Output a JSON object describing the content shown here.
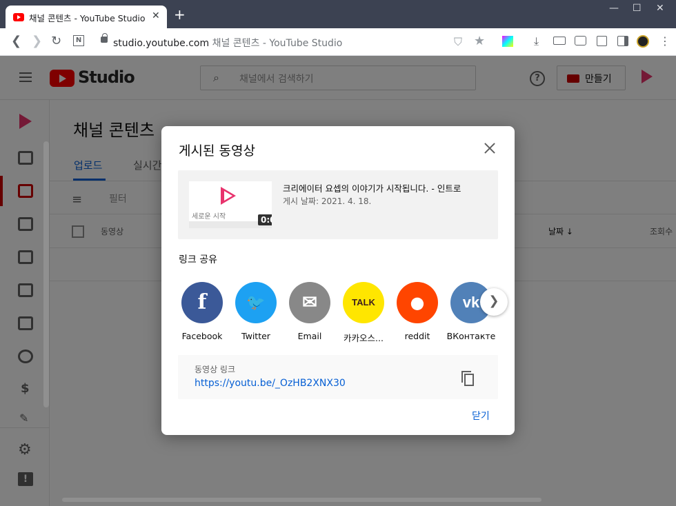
{
  "browser": {
    "tab_title": "채널 콘텐츠 - YouTube Studio",
    "tab_close": "✕",
    "new_tab": "+",
    "url_domain": "studio.youtube.com",
    "url_page_title": "채널 콘텐츠 - YouTube Studio",
    "window_controls": {
      "minimize": "—",
      "maximize": "☐",
      "close": "✕"
    }
  },
  "studio": {
    "logo_text": "Studio",
    "search_placeholder": "채널에서 검색하기",
    "create_label": "만들기",
    "page_title": "채널 콘텐츠",
    "tabs": [
      "업로드",
      "실시간"
    ],
    "filter_label": "필터",
    "columns": {
      "video": "동영상",
      "date": "날짜 ↓",
      "views": "조회수"
    }
  },
  "dialog": {
    "title": "게시된 동영상",
    "video": {
      "title": "크리에이터 요셉의 이야기가 시작됩니다. - 인트로",
      "published": "게시 날짜: 2021. 4. 18.",
      "duration": "0:08",
      "thumb_caption": "세로운 시작"
    },
    "share_label": "링크 공유",
    "share_targets": [
      {
        "name": "Facebook",
        "glyph": "f",
        "color": "#3b5998"
      },
      {
        "name": "Twitter",
        "glyph": "🐦",
        "color": "#1da1f2"
      },
      {
        "name": "Email",
        "glyph": "✉",
        "color": "#888888"
      },
      {
        "name": "카카오스...",
        "glyph": "TALK",
        "color": "#ffe600"
      },
      {
        "name": "reddit",
        "glyph": "●",
        "color": "#ff4500"
      },
      {
        "name": "ВКонтакте",
        "glyph": "vk",
        "color": "#5181b8"
      }
    ],
    "link_label": "동영상 링크",
    "link_url": "https://youtu.be/_OzHB2XNX30",
    "close_label": "닫기"
  }
}
